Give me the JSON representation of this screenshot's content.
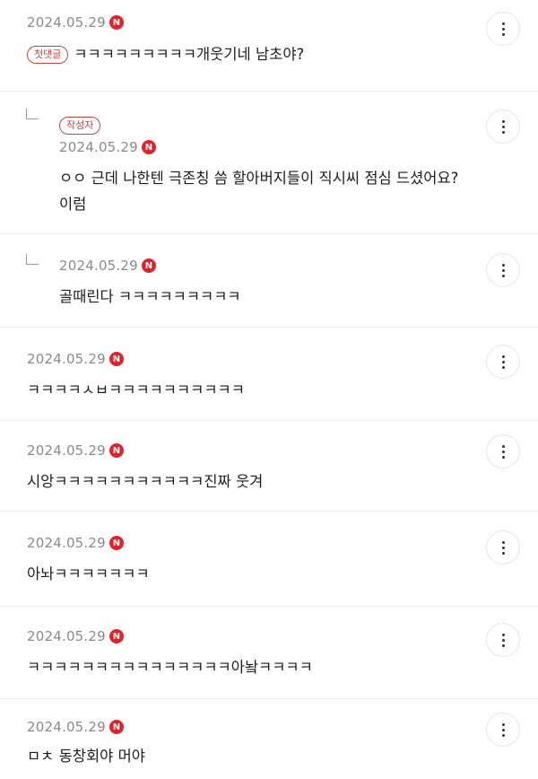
{
  "badge_new": "N",
  "comments": [
    {
      "date": "2024.05.29",
      "tag": "첫댓글",
      "text": "ㅋㅋㅋㅋㅋㅋㅋㅋㅋ개웃기네 남초야?"
    },
    {
      "date": "2024.05.29",
      "tag": "작성자",
      "text_line1": "ㅇㅇ 근데 나한텐 극존칭 씀 할아버지들이 직시씨 점심 드셨어요?",
      "text_line2": "이럼"
    },
    {
      "date": "2024.05.29",
      "text": "골때린다 ㅋㅋㅋㅋㅋㅋㅋㅋㅋ"
    },
    {
      "date": "2024.05.29",
      "text": "ㅋㅋㅋㅋㅅㅂㅋㅋㅋㅋㅋㅋㅋㅋㅋㅋ"
    },
    {
      "date": "2024.05.29",
      "text": "시앙ㅋㅋㅋㅋㅋㅋㅋㅋㅋㅋㅋ진짜 웃겨"
    },
    {
      "date": "2024.05.29",
      "text": "아놔ㅋㅋㅋㅋㅋㅋㅋ"
    },
    {
      "date": "2024.05.29",
      "text": "ㅋㅋㅋㅋㅋㅋㅋㅋㅋㅋㅋㅋㅋㅋㅋ아놬ㅋㅋㅋㅋ"
    },
    {
      "date": "2024.05.29",
      "text": "ㅁㅊ 동창회야 머야"
    }
  ]
}
